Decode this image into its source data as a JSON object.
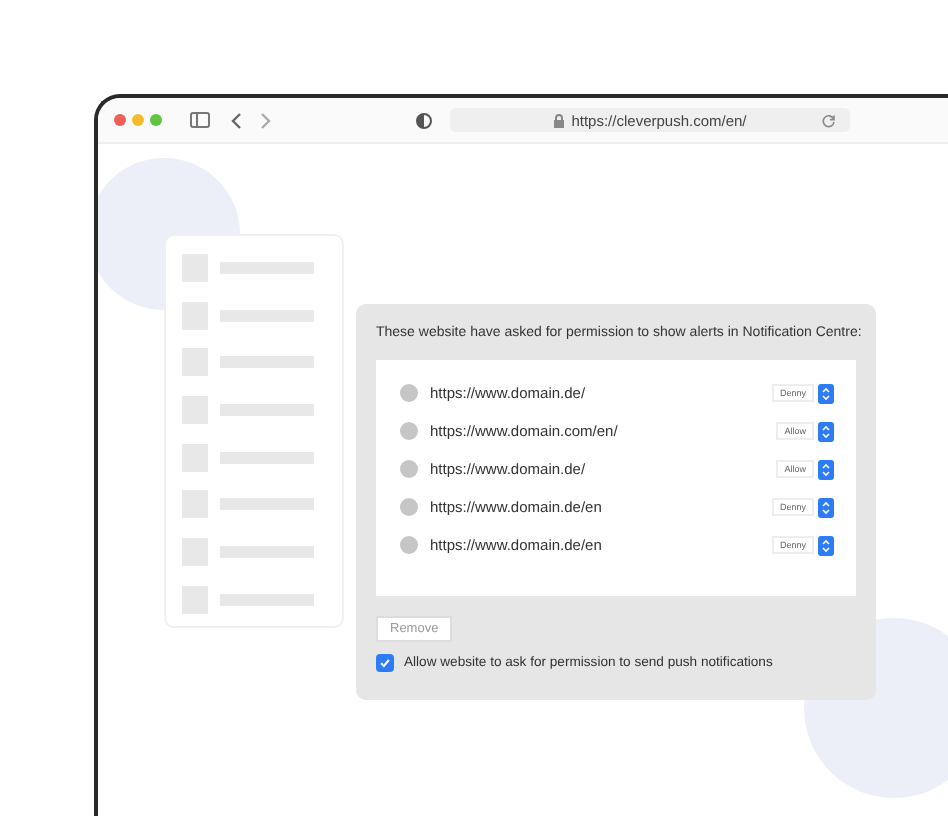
{
  "browser": {
    "url": "https://cleverpush.com/en/"
  },
  "dialog": {
    "title": "These website have asked for permission to show alerts in Notification Centre:",
    "sites": [
      {
        "url": "https://www.domain.de/",
        "permission": "Denny"
      },
      {
        "url": "https://www.domain.com/en/",
        "permission": "Allow"
      },
      {
        "url": "https://www.domain.de/",
        "permission": "Allow"
      },
      {
        "url": "https://www.domain.de/en",
        "permission": "Denny"
      },
      {
        "url": "https://www.domain.de/en",
        "permission": "Denny"
      }
    ],
    "remove_button": {
      "label": "Remove",
      "disabled": true
    },
    "allow_checkbox": {
      "label": "Allow website to ask for permission to send push notifications",
      "checked": true
    }
  }
}
